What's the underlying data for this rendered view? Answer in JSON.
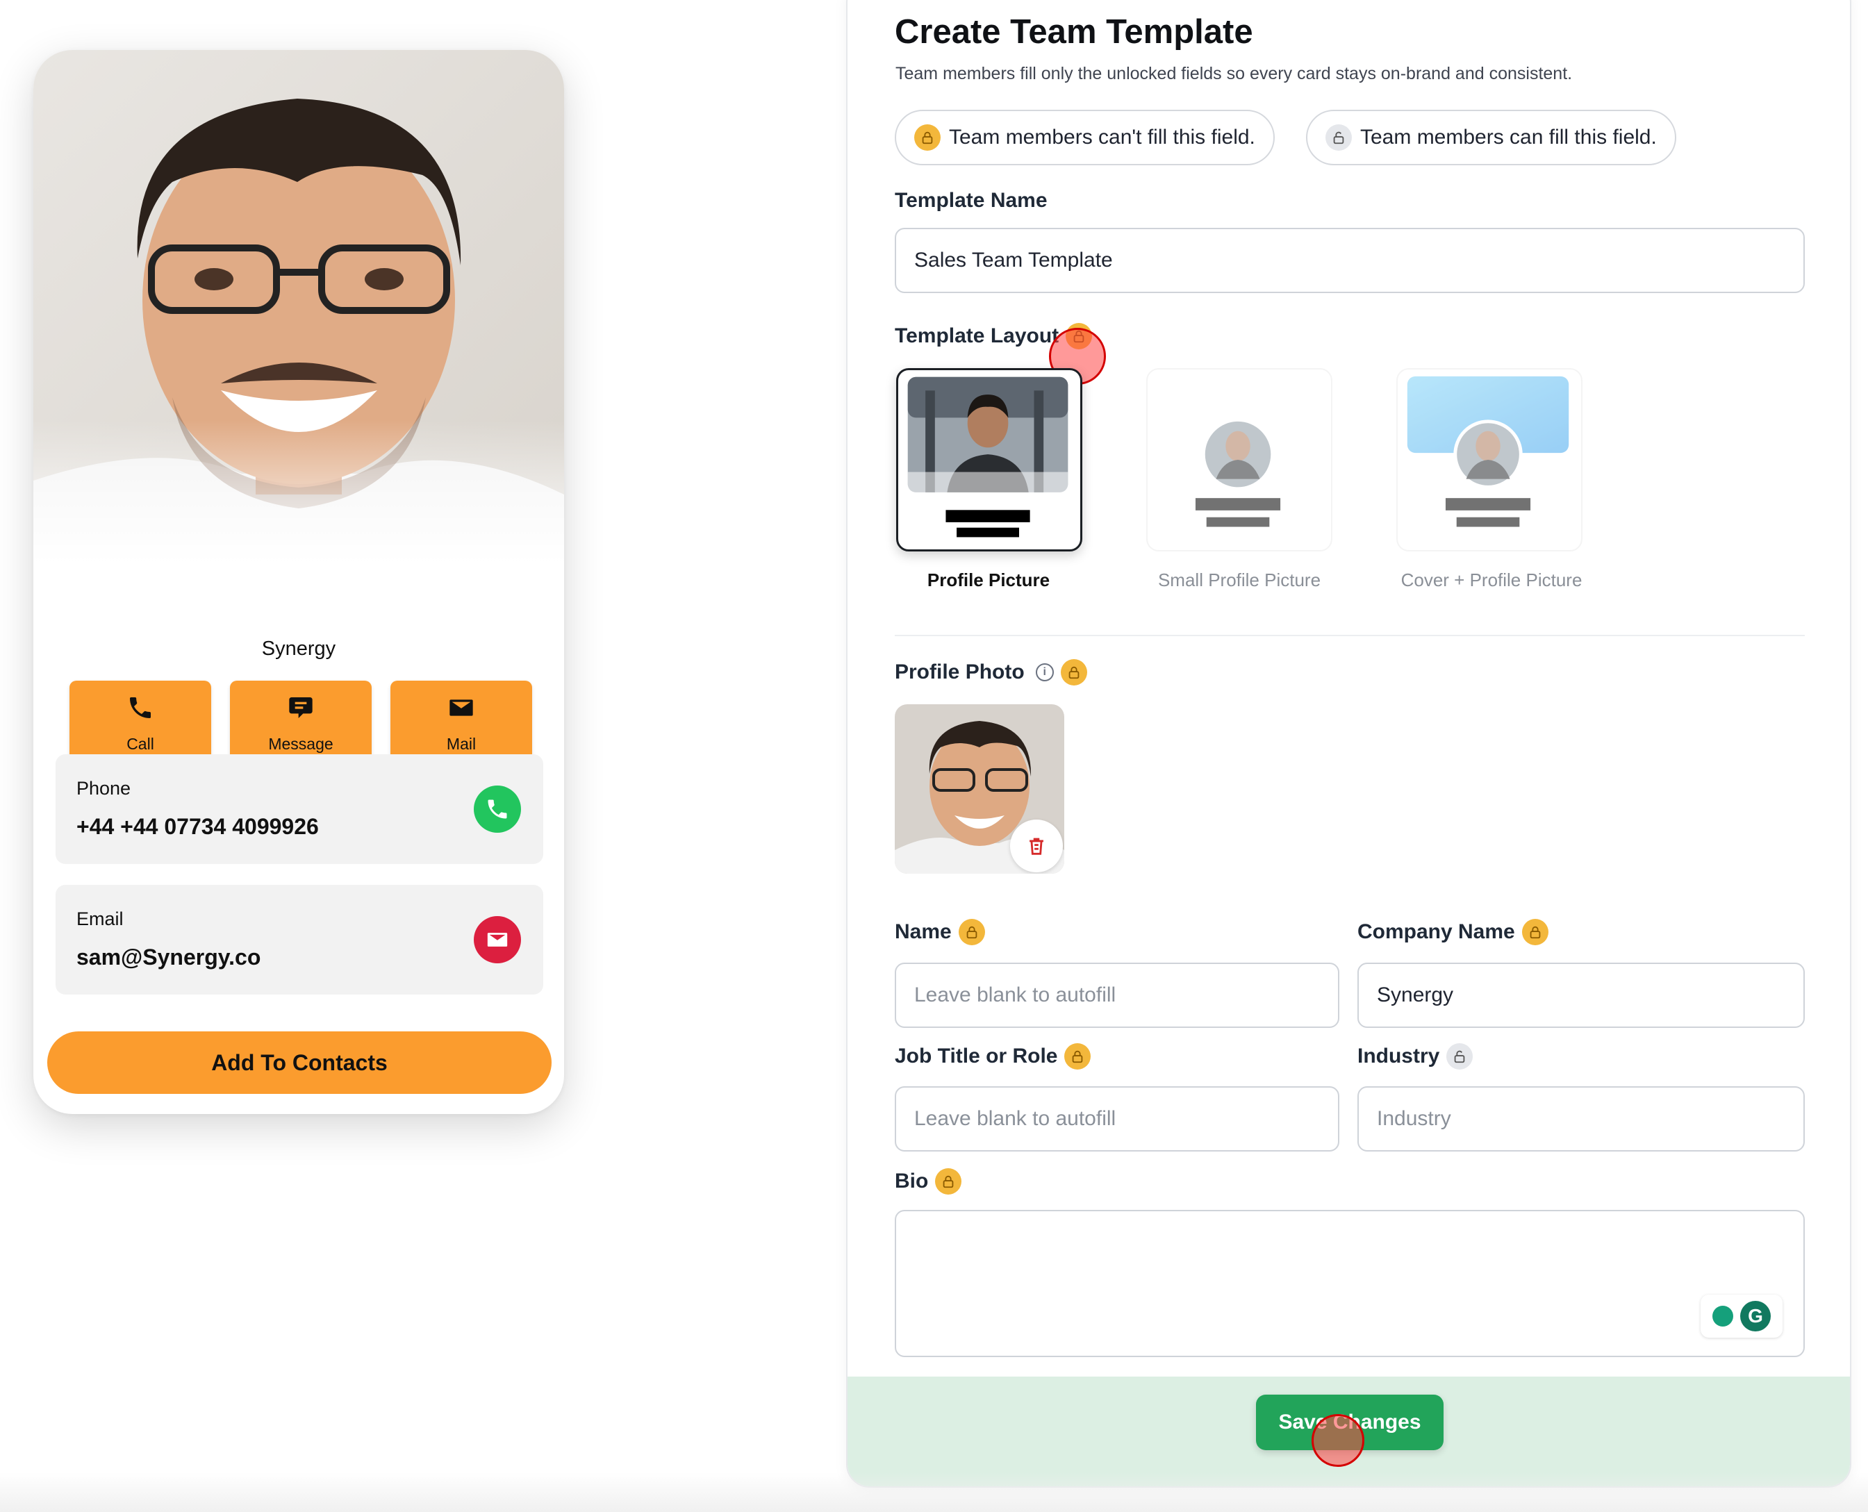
{
  "preview": {
    "company": "Synergy",
    "actions": [
      {
        "label": "Call",
        "icon": "phone-icon"
      },
      {
        "label": "Message",
        "icon": "message-icon"
      },
      {
        "label": "Mail",
        "icon": "mail-icon"
      }
    ],
    "phone": {
      "label": "Phone",
      "value": "+44 +44 07734 4099926"
    },
    "email": {
      "label": "Email",
      "value": "sam@Synergy.co"
    },
    "add_contacts": "Add To Contacts",
    "accent_color": "#fb9c2e"
  },
  "form": {
    "title": "Create Team Template",
    "subtitle": "Team members fill only the unlocked fields so every card stays on-brand and consistent.",
    "legend": {
      "locked": "Team members can't fill this field.",
      "unlocked": "Team members can fill this field."
    },
    "template_name": {
      "label": "Template Name",
      "value": "Sales Team Template"
    },
    "template_layout": {
      "label": "Template Layout",
      "options": [
        {
          "label": "Profile Picture",
          "selected": true
        },
        {
          "label": "Small Profile Picture",
          "selected": false
        },
        {
          "label": "Cover + Profile Picture",
          "selected": false
        }
      ]
    },
    "profile_photo": {
      "label": "Profile Photo"
    },
    "name": {
      "label": "Name",
      "placeholder": "Leave blank to autofill"
    },
    "company_name": {
      "label": "Company Name",
      "value": "Synergy"
    },
    "job_title": {
      "label": "Job Title or Role",
      "placeholder": "Leave blank to autofill"
    },
    "industry": {
      "label": "Industry",
      "placeholder": "Industry"
    },
    "bio": {
      "label": "Bio",
      "value": ""
    },
    "save_label": "Save Changes",
    "save_color": "#22a45a"
  }
}
